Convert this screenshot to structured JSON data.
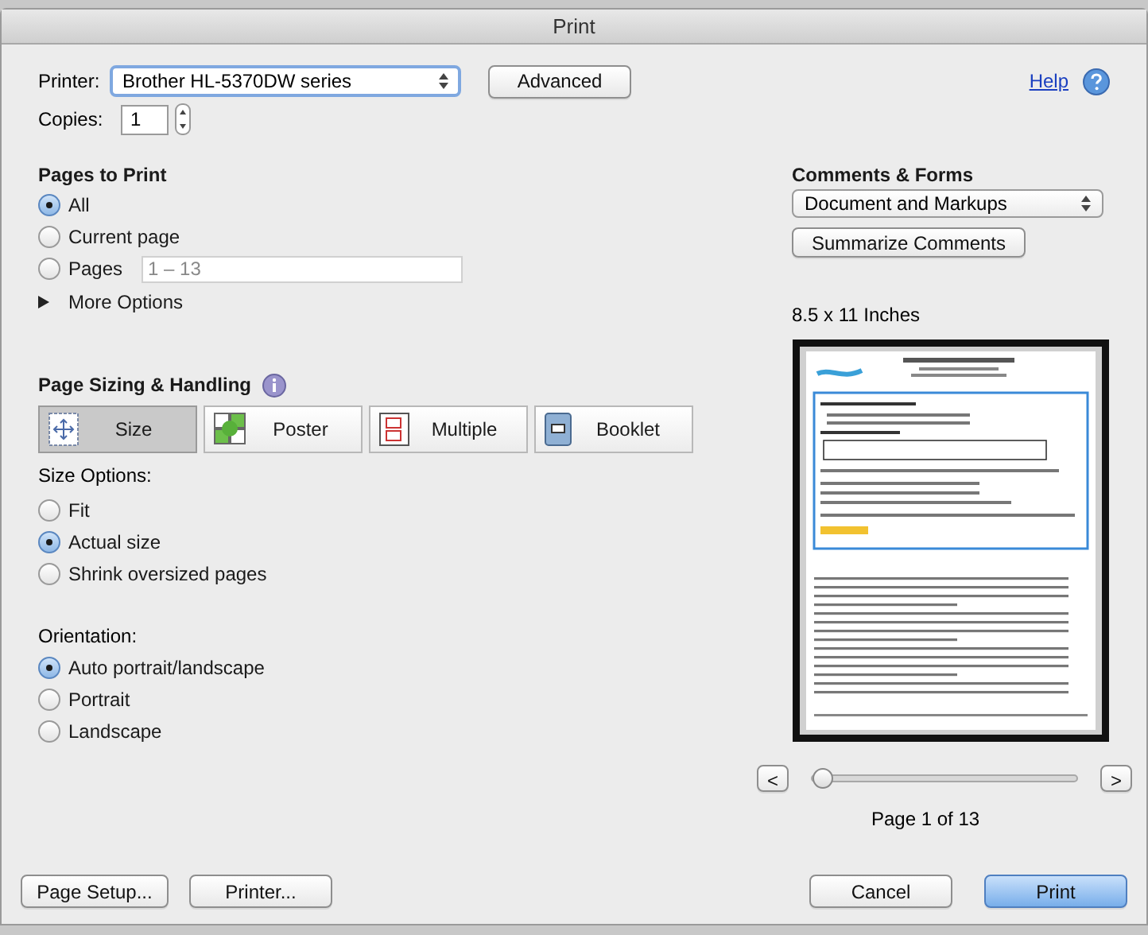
{
  "window": {
    "title": "Print"
  },
  "printer": {
    "label": "Printer:",
    "value": "Brother HL-5370DW series"
  },
  "advanced_button": "Advanced",
  "help_link": "Help",
  "copies": {
    "label": "Copies:",
    "value": "1"
  },
  "pages_to_print": {
    "title": "Pages to Print",
    "options": [
      {
        "label": "All",
        "selected": true
      },
      {
        "label": "Current page",
        "selected": false
      },
      {
        "label": "Pages",
        "selected": false
      }
    ],
    "pages_field": {
      "placeholder": "1 – 13"
    },
    "more_options": {
      "label": "More Options",
      "expanded": false
    }
  },
  "page_sizing": {
    "title": "Page Sizing & Handling",
    "tabs": [
      {
        "label": "Size",
        "kind": "size",
        "selected": true
      },
      {
        "label": "Poster",
        "kind": "poster",
        "selected": false
      },
      {
        "label": "Multiple",
        "kind": "multiple",
        "selected": false
      },
      {
        "label": "Booklet",
        "kind": "booklet",
        "selected": false
      }
    ],
    "size_options_label": "Size Options:",
    "size_options": [
      {
        "label": "Fit",
        "selected": false
      },
      {
        "label": "Actual size",
        "selected": true
      },
      {
        "label": "Shrink oversized pages",
        "selected": false
      }
    ],
    "orientation_label": "Orientation:",
    "orientation": [
      {
        "label": "Auto portrait/landscape",
        "selected": true
      },
      {
        "label": "Portrait",
        "selected": false
      },
      {
        "label": "Landscape",
        "selected": false
      }
    ]
  },
  "comments_forms": {
    "title": "Comments & Forms",
    "value": "Document and Markups",
    "summarize_button": "Summarize Comments"
  },
  "preview": {
    "paper_size": "8.5 x 11 Inches",
    "prev_button": "<",
    "next_button": ">",
    "slider": {
      "level": 0
    },
    "page_label": "Page 1 of 13"
  },
  "buttons": {
    "page_setup": "Page Setup...",
    "printer": "Printer...",
    "cancel": "Cancel",
    "print": "Print"
  }
}
